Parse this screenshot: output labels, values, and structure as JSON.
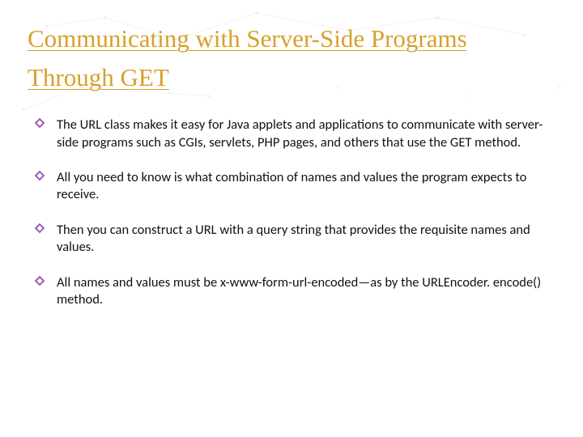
{
  "title": "Communicating with Server-Side Programs Through GET",
  "bullets": [
    "The URL class makes it easy for Java applets and applications to communicate with server-side programs such as CGIs, servlets, PHP pages, and others that use the GET method.",
    "All you need to know is what combination of names and values the program expects to receive.",
    "Then you can construct a URL with a query string that provides the requisite names and values.",
    "All names and values must be x-www-form-url-encoded—as by the URLEncoder. encode() method."
  ],
  "colors": {
    "title": "#d7a02c",
    "bullet_icon": "#9b59b6",
    "text": "#111111"
  }
}
